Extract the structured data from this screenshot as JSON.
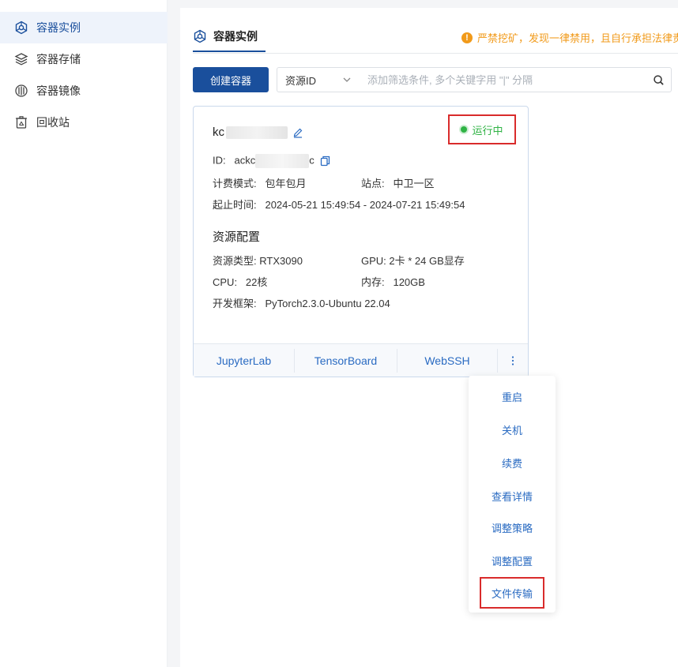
{
  "sidebar": {
    "items": [
      {
        "label": "容器实例",
        "icon": "container-instance-icon",
        "active": true
      },
      {
        "label": "容器存储",
        "icon": "layers-storage-icon",
        "active": false
      },
      {
        "label": "容器镜像",
        "icon": "image-disc-icon",
        "active": false
      },
      {
        "label": "回收站",
        "icon": "recycle-bin-icon",
        "active": false
      }
    ]
  },
  "main": {
    "tab": {
      "label": "容器实例",
      "icon": "container-instance-icon"
    },
    "warning": "严禁挖矿，发现一律禁用，且自行承担法律责任",
    "create_button": "创建容器",
    "filter": {
      "select_value": "资源ID",
      "placeholder": "添加筛选条件, 多个关键字用 \"|\" 分隔"
    }
  },
  "card": {
    "name_prefix": "kc",
    "status": "运行中",
    "id_label": "ID:",
    "id_prefix": "ackc",
    "id_suffix": "c",
    "billing_label": "计费模式:",
    "billing_value": "包年包月",
    "site_label": "站点:",
    "site_value": "中卫一区",
    "time_label": "起止时间:",
    "time_value": "2024-05-21 15:49:54 - 2024-07-21 15:49:54",
    "section_title": "资源配置",
    "resource_type_label": "资源类型:",
    "resource_type_value": "RTX3090",
    "gpu_label": "GPU:",
    "gpu_value": "2卡 * 24 GB显存",
    "cpu_label": "CPU:",
    "cpu_value": "22核",
    "memory_label": "内存:",
    "memory_value": "120GB",
    "framework_label": "开发框架:",
    "framework_value": "PyTorch2.3.0-Ubuntu 22.04",
    "footer": {
      "jupyter": "JupyterLab",
      "tensorboard": "TensorBoard",
      "webssh": "WebSSH"
    }
  },
  "dropdown": {
    "items": [
      "重启",
      "关机",
      "续费",
      "查看详情",
      "调整策略",
      "调整配置",
      "文件传输"
    ]
  },
  "colors": {
    "primary": "#1a4f9c",
    "link": "#2a6bc2",
    "running": "#2fb344",
    "warning": "#f19a1a",
    "highlight": "#d92b2b"
  }
}
